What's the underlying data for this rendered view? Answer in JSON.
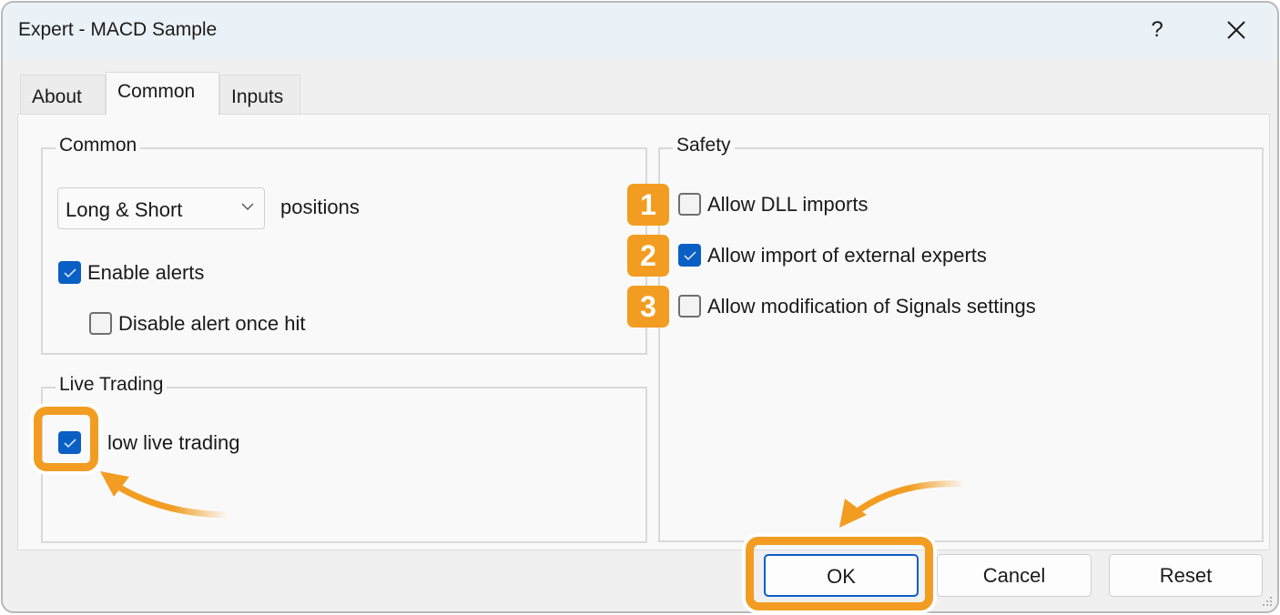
{
  "window": {
    "title": "Expert - MACD Sample",
    "help_label": "?",
    "close_label": "✕"
  },
  "tabs": [
    {
      "label": "About",
      "active": false
    },
    {
      "label": "Common",
      "active": true
    },
    {
      "label": "Inputs",
      "active": false
    }
  ],
  "common_group": {
    "legend": "Common",
    "positions_select": {
      "value": "Long & Short",
      "icon": "chevron-down-icon"
    },
    "positions_label": "positions",
    "enable_alerts": {
      "label": "Enable alerts",
      "checked": true
    },
    "disable_alert_once_hit": {
      "label": "Disable alert once hit",
      "checked": false
    }
  },
  "live_trading_group": {
    "legend": "Live Trading",
    "allow_live_trading": {
      "label": "low live trading",
      "checked": true
    }
  },
  "safety_group": {
    "legend": "Safety",
    "items": [
      {
        "badge": "1",
        "label": "Allow DLL imports",
        "checked": false
      },
      {
        "badge": "2",
        "label": "Allow import of external experts",
        "checked": true
      },
      {
        "badge": "3",
        "label": "Allow modification of Signals settings",
        "checked": false
      }
    ]
  },
  "buttons": {
    "ok": "OK",
    "cancel": "Cancel",
    "reset": "Reset"
  },
  "annotation": {
    "accent_color": "#f29d22",
    "checkbox_color": "#0a5fc4"
  }
}
